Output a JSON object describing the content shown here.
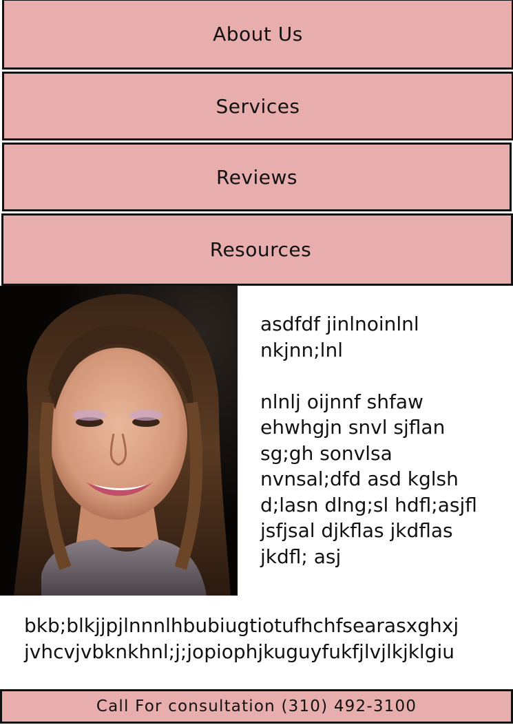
{
  "nav": {
    "items": [
      {
        "label": "About Us"
      },
      {
        "label": "Services"
      },
      {
        "label": "Reviews"
      },
      {
        "label": "Resources"
      }
    ]
  },
  "profile": {
    "bio": "asdfdf  jinlnoinlnl\nnkjnn;lnl\n\nnlnlj oijnnf shfaw\nehwhgjn snvl sjflan\nsg;gh sonvlsa\nnvnsal;dfd asd kglsh\nd;lasn dlng;sl hdfl;asjfl\njsfjsal djkflas jkdflas\njkdfl; asj"
  },
  "footer": {
    "text": "bkb;blkjjpjlnnnlhbubiugtiotufhchfsearasxghxj\njvhcvjvbknkhnl;j;jopiophjkuguyfukfjlvjlkjklgiu"
  },
  "cta": {
    "label": "Call For consultation (310) 492-3100"
  },
  "colors": {
    "button_bg": "#e8adad",
    "border": "#111111",
    "text": "#111111"
  }
}
